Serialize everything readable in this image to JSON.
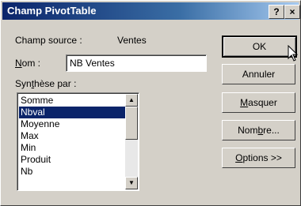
{
  "window": {
    "title": "Champ PivotTable",
    "help_label": "?",
    "close_label": "×"
  },
  "source": {
    "label": "Champ source :",
    "value": "Ventes"
  },
  "nom": {
    "label": "Nom :",
    "value": "NB Ventes"
  },
  "synthese": {
    "label": "Synthèse par :",
    "items": [
      "Somme",
      "Nbval",
      "Moyenne",
      "Max",
      "Min",
      "Produit",
      "Nb"
    ],
    "selected": "Nbval"
  },
  "buttons": {
    "ok": "OK",
    "annuler": "Annuler",
    "masquer": "Masquer",
    "nombre": "Nombre...",
    "options": "Options >>"
  }
}
